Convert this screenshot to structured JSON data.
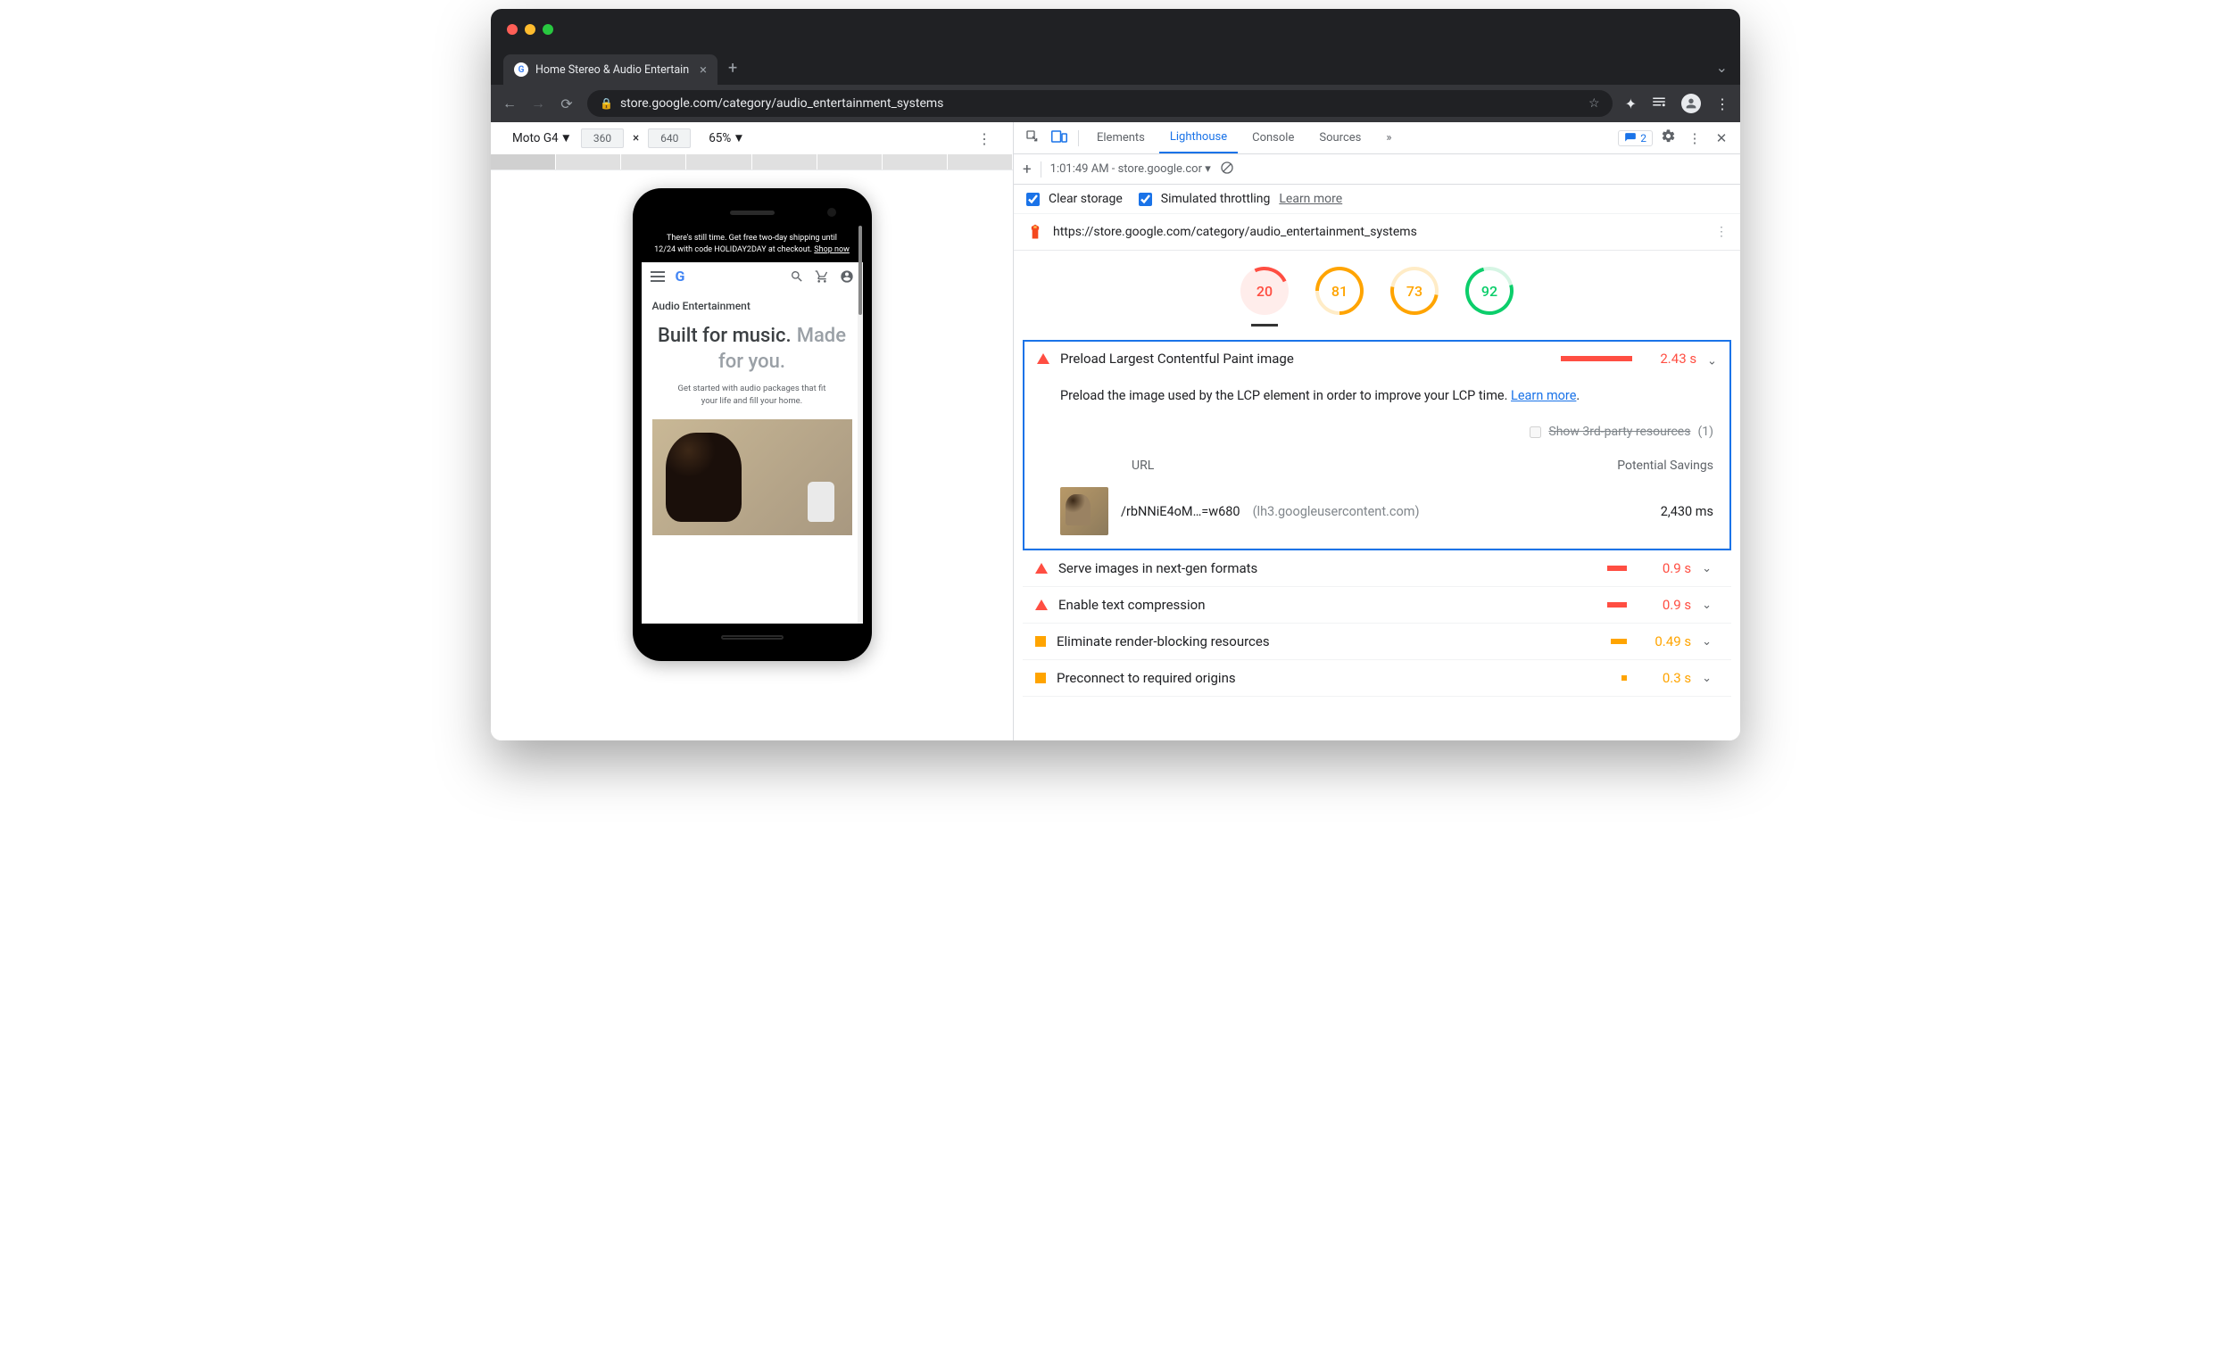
{
  "browser": {
    "tab_title": "Home Stereo & Audio Entertain",
    "url": "store.google.com/category/audio_entertainment_systems"
  },
  "device_toolbar": {
    "device": "Moto G4",
    "width": "360",
    "height": "640",
    "zoom": "65%"
  },
  "mobile_site": {
    "banner_line1": "There's still time. Get free two-day shipping until",
    "banner_line2_a": "12/24 with code HOLIDAY2DAY at checkout.",
    "banner_shop": "Shop now",
    "category": "Audio Entertainment",
    "headline_1": "Built for music.",
    "headline_2": "Made for you.",
    "sub": "Get started with audio packages that fit your life and fill your home."
  },
  "devtools": {
    "tabs": [
      "Elements",
      "Lighthouse",
      "Console",
      "Sources"
    ],
    "overflow": "»",
    "issues_count": "2"
  },
  "lh_toolbar": {
    "timestamp": "1:01:49 AM - store.google.cor"
  },
  "lh_options": {
    "clear_storage": "Clear storage",
    "simulated": "Simulated throttling",
    "learn_more": "Learn more"
  },
  "lh_url": "https://store.google.com/category/audio_entertainment_systems",
  "scores": {
    "s1": "20",
    "s2": "81",
    "s3": "73",
    "s4": "92"
  },
  "main_audit": {
    "title": "Preload Largest Contentful Paint image",
    "value": "2.43 s",
    "description": "Preload the image used by the LCP element in order to improve your LCP time.",
    "learn_more": "Learn more",
    "show_third_party": "Show 3rd-party resources",
    "third_party_count": "(1)",
    "col_url": "URL",
    "col_savings": "Potential Savings",
    "row_path": "/rbNNiE4oM…=w680",
    "row_host": "(lh3.googleusercontent.com)",
    "row_savings": "2,430 ms"
  },
  "audits": [
    {
      "severity": "red",
      "title": "Serve images in next-gen formats",
      "value": "0.9 s"
    },
    {
      "severity": "red",
      "title": "Enable text compression",
      "value": "0.9 s"
    },
    {
      "severity": "orange",
      "title": "Eliminate render-blocking resources",
      "value": "0.49 s"
    },
    {
      "severity": "orange",
      "title": "Preconnect to required origins",
      "value": "0.3 s"
    }
  ]
}
